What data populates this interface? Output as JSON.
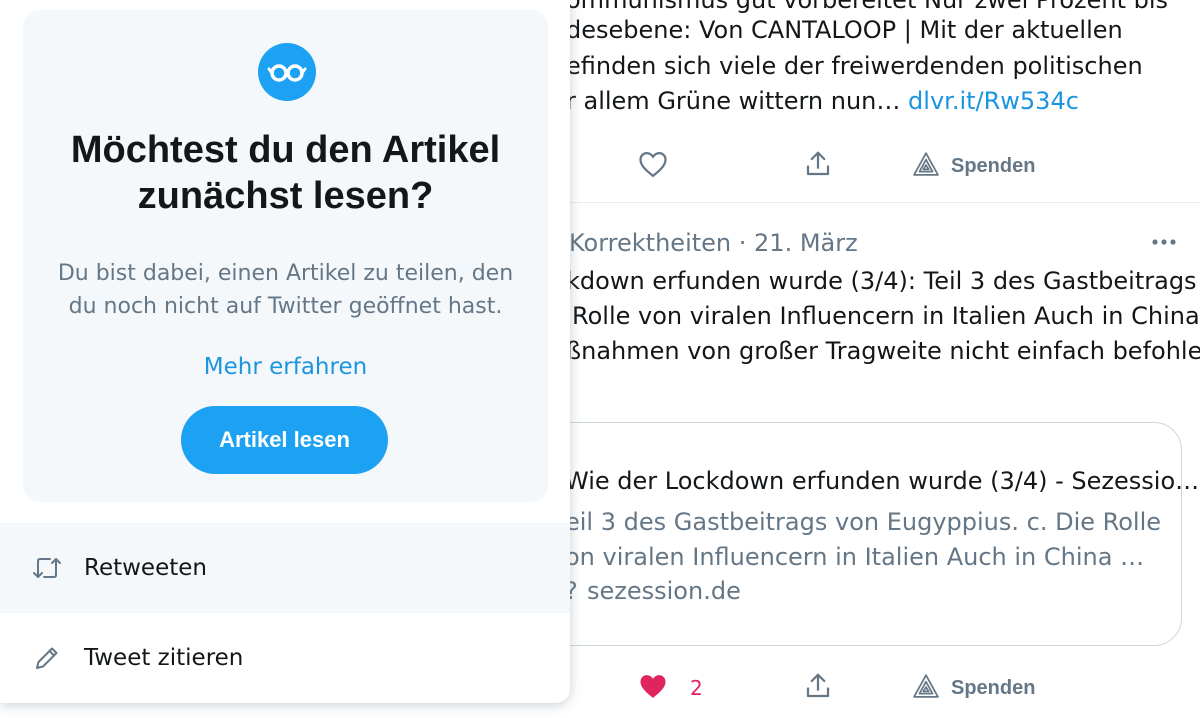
{
  "timeline": {
    "tweet1": {
      "lines": [
        "ommunismus gut vorbereitet Nur zwei Prozent bis",
        "desebene: Von CANTALOOP | Mit der aktuellen",
        "efinden sich viele der freiwerdenden politischen",
        "r allem Grüne wittern nun…"
      ],
      "link": "dlvr.it/Rw534c",
      "actions": {
        "donate_label": "Spenden"
      }
    },
    "tweet2": {
      "author_tail": "Korrektheiten",
      "date": "· 21. März",
      "lines": [
        "kdown erfunden wurde (3/4): Teil 3 des Gastbeitrags",
        "Rolle von viralen Influencern in Italien Auch in China",
        "ßnahmen von großer Tragweite nicht einfach befohlen"
      ],
      "card": {
        "title": "Wie der Lockdown erfunden wurde (3/4) - Sezessio…",
        "desc_lines": [
          "eil 3 des Gastbeitrags von Eugyppius.    c. Die Rolle",
          "on viralen Influencern in Italien Auch in China …"
        ],
        "domain": "sezession.de"
      },
      "actions": {
        "like_count": "2",
        "donate_label": "Spenden"
      }
    }
  },
  "popup": {
    "title": "Möchtest du den Artikel zunächst lesen?",
    "description": "Du bist dabei, einen Artikel zu teilen, den du noch nicht auf Twitter geöffnet hast.",
    "learn_more": "Mehr erfahren",
    "read_button": "Artikel lesen",
    "menu": [
      {
        "label": "Retweeten",
        "icon": "retweet-icon"
      },
      {
        "label": "Tweet zitieren",
        "icon": "pencil-icon"
      }
    ]
  },
  "colors": {
    "accent": "#1da1f2",
    "link": "#1b95e0",
    "like": "#e0245e",
    "secondary_text": "#657786"
  }
}
